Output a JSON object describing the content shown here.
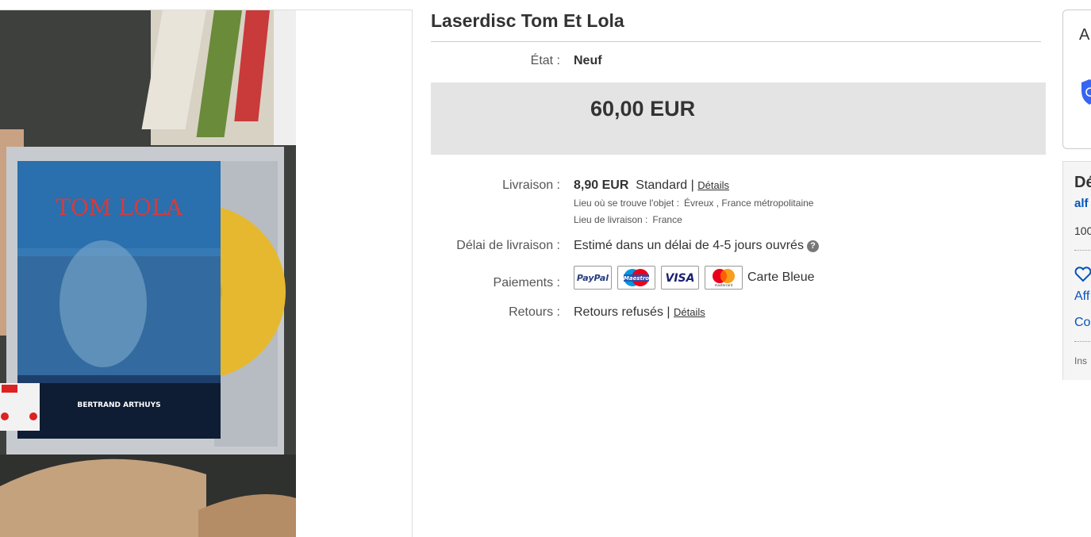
{
  "listing": {
    "title": "Laserdisc Tom Et Lola",
    "condition_label": "État :",
    "condition_value": "Neuf",
    "price": "60,00 EUR"
  },
  "shipping": {
    "label": "Livraison :",
    "cost": "8,90 EUR",
    "method": "Standard |",
    "details_link": "Détails",
    "item_location_label": "Lieu où se trouve l'objet :",
    "item_location_value": "Évreux , France métropolitaine",
    "ships_to_label": "Lieu de livraison :",
    "ships_to_value": "France"
  },
  "delivery": {
    "label": "Délai de livraison :",
    "value": "Estimé dans un délai de 4-5 jours ouvrés",
    "help_icon": "?"
  },
  "payments": {
    "label": "Paiements :",
    "methods": [
      {
        "icon": "paypal-logo",
        "text": "PayPal"
      },
      {
        "icon": "maestro-logo",
        "text": "Maestro"
      },
      {
        "icon": "visa-logo",
        "text": "VISA"
      },
      {
        "icon": "mastercard-logo",
        "text": "mastercard"
      }
    ],
    "extra": "Carte Bleue"
  },
  "returns": {
    "label": "Retours :",
    "value": "Retours refusés |",
    "details_link": "Détails"
  },
  "photo": {
    "cover_title": "TOM LOLA",
    "cover_director": "BERTRAND ARTHUYS"
  },
  "right_panel": {
    "box1_title_partial": "A",
    "box2_title_partial": "Dé",
    "seller_partial": "alf",
    "score_partial": "100",
    "follow_partial": "Aff",
    "contact_partial": "Co",
    "insc_partial": "Ins"
  },
  "colors": {
    "link_blue": "#0654ba",
    "price_band": "#e4e4e4",
    "paypal_blue": "#253b80",
    "visa_blue": "#1a1f71",
    "mc_red": "#eb001b",
    "mc_orange": "#f79e1b"
  }
}
